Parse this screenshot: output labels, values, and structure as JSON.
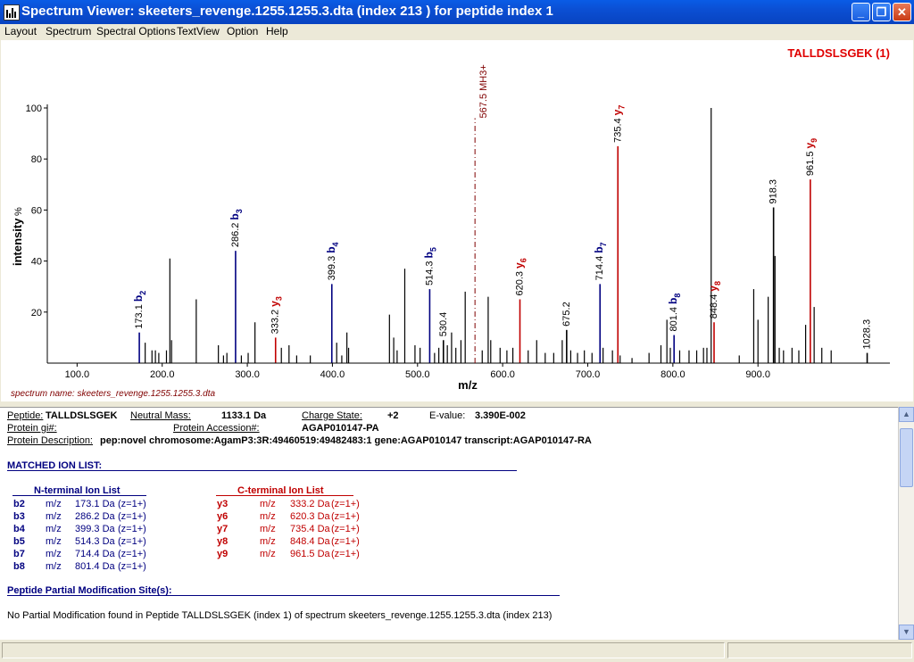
{
  "window": {
    "title": "Spectrum Viewer: skeeters_revenge.1255.1255.3.dta (index 213 ) for peptide index 1",
    "minimize_glyph": "_",
    "maximize_glyph": "❐",
    "close_glyph": "✕",
    "app_icon": "spectrum-icon"
  },
  "menu": [
    "Layout",
    "Spectrum",
    "Spectral Options",
    "TextView",
    "Option",
    "Help"
  ],
  "plot": {
    "peptide_label": "TALLDSLSGEK (1)",
    "ylabel": "intensity",
    "ylabel_unit": "%",
    "xlabel": "m/z",
    "spectrum_name": "spectrum name: skeeters_revenge.1255.1255.3.dta",
    "precursor_label": "567.5 MH3+"
  },
  "chart_data": {
    "type": "bar",
    "xlim": [
      65,
      1055
    ],
    "ylim": [
      0,
      100
    ],
    "x_ticks": [
      100,
      200,
      300,
      400,
      500,
      600,
      700,
      800,
      900
    ],
    "x_tick_labels": [
      "100.0",
      "200.0",
      "300.0",
      "400.0",
      "500.0",
      "600.0",
      "700.0",
      "800.0",
      "900.0"
    ],
    "y_ticks": [
      20,
      40,
      60,
      80,
      100
    ],
    "y_tick_labels": [
      "20",
      "40",
      "60",
      "80",
      "100"
    ],
    "precursor_mz": 567.5,
    "peaks": [
      {
        "mz": 173.1,
        "y": 12,
        "type": "b",
        "label": "173.1",
        "ion": "b",
        "idx": "2"
      },
      {
        "mz": 180,
        "y": 8
      },
      {
        "mz": 188,
        "y": 5
      },
      {
        "mz": 192,
        "y": 5
      },
      {
        "mz": 196,
        "y": 4
      },
      {
        "mz": 205,
        "y": 5
      },
      {
        "mz": 209,
        "y": 41
      },
      {
        "mz": 211,
        "y": 9
      },
      {
        "mz": 240,
        "y": 25
      },
      {
        "mz": 266,
        "y": 7
      },
      {
        "mz": 272,
        "y": 3
      },
      {
        "mz": 276,
        "y": 4
      },
      {
        "mz": 286.2,
        "y": 44,
        "type": "b",
        "label": "286.2",
        "ion": "b",
        "idx": "3"
      },
      {
        "mz": 293,
        "y": 3
      },
      {
        "mz": 301,
        "y": 4
      },
      {
        "mz": 309,
        "y": 16
      },
      {
        "mz": 333.2,
        "y": 10,
        "type": "y",
        "label": "333.2",
        "ion": "y",
        "idx": "3"
      },
      {
        "mz": 340,
        "y": 6
      },
      {
        "mz": 349,
        "y": 7
      },
      {
        "mz": 358,
        "y": 3
      },
      {
        "mz": 374,
        "y": 3
      },
      {
        "mz": 399.3,
        "y": 31,
        "type": "b",
        "label": "399.3",
        "ion": "b",
        "idx": "4"
      },
      {
        "mz": 405,
        "y": 8
      },
      {
        "mz": 411,
        "y": 3
      },
      {
        "mz": 417,
        "y": 12
      },
      {
        "mz": 419,
        "y": 6
      },
      {
        "mz": 467,
        "y": 19
      },
      {
        "mz": 472,
        "y": 10
      },
      {
        "mz": 476,
        "y": 5
      },
      {
        "mz": 485,
        "y": 37
      },
      {
        "mz": 497,
        "y": 7
      },
      {
        "mz": 503,
        "y": 6
      },
      {
        "mz": 514.3,
        "y": 29,
        "type": "b",
        "label": "514.3",
        "ion": "b",
        "idx": "5"
      },
      {
        "mz": 520,
        "y": 4
      },
      {
        "mz": 525,
        "y": 6
      },
      {
        "mz": 530.4,
        "y": 9,
        "label": "530.4"
      },
      {
        "mz": 535,
        "y": 7
      },
      {
        "mz": 540,
        "y": 12
      },
      {
        "mz": 545,
        "y": 6
      },
      {
        "mz": 551,
        "y": 9
      },
      {
        "mz": 556,
        "y": 28
      },
      {
        "mz": 576,
        "y": 5
      },
      {
        "mz": 583,
        "y": 26
      },
      {
        "mz": 586,
        "y": 9
      },
      {
        "mz": 597,
        "y": 6
      },
      {
        "mz": 605,
        "y": 5
      },
      {
        "mz": 612,
        "y": 6
      },
      {
        "mz": 620.3,
        "y": 25,
        "type": "y",
        "label": "620.3",
        "ion": "y",
        "idx": "6"
      },
      {
        "mz": 630,
        "y": 5
      },
      {
        "mz": 640,
        "y": 9
      },
      {
        "mz": 650,
        "y": 4
      },
      {
        "mz": 660,
        "y": 4
      },
      {
        "mz": 670,
        "y": 9
      },
      {
        "mz": 675.2,
        "y": 13,
        "label": "675.2"
      },
      {
        "mz": 680,
        "y": 5
      },
      {
        "mz": 688,
        "y": 4
      },
      {
        "mz": 696,
        "y": 5
      },
      {
        "mz": 705,
        "y": 4
      },
      {
        "mz": 714.4,
        "y": 31,
        "type": "b",
        "label": "714.4",
        "ion": "b",
        "idx": "7"
      },
      {
        "mz": 718,
        "y": 6
      },
      {
        "mz": 729,
        "y": 5
      },
      {
        "mz": 735.4,
        "y": 85,
        "type": "y",
        "label": "735.4",
        "ion": "y",
        "idx": "7"
      },
      {
        "mz": 738,
        "y": 3
      },
      {
        "mz": 752,
        "y": 2
      },
      {
        "mz": 772,
        "y": 4
      },
      {
        "mz": 786,
        "y": 7
      },
      {
        "mz": 793,
        "y": 17
      },
      {
        "mz": 797,
        "y": 6
      },
      {
        "mz": 801.4,
        "y": 11,
        "type": "b",
        "label": "801.4",
        "ion": "b",
        "idx": "8"
      },
      {
        "mz": 808,
        "y": 5
      },
      {
        "mz": 819,
        "y": 5
      },
      {
        "mz": 828,
        "y": 5
      },
      {
        "mz": 836,
        "y": 6
      },
      {
        "mz": 840,
        "y": 6
      },
      {
        "mz": 845,
        "y": 100
      },
      {
        "mz": 848.4,
        "y": 16,
        "type": "y",
        "label": "848.4",
        "ion": "y",
        "idx": "8"
      },
      {
        "mz": 878,
        "y": 3
      },
      {
        "mz": 895,
        "y": 29
      },
      {
        "mz": 900,
        "y": 17
      },
      {
        "mz": 912,
        "y": 26
      },
      {
        "mz": 918.3,
        "y": 61,
        "label": "918.3"
      },
      {
        "mz": 920,
        "y": 42
      },
      {
        "mz": 925,
        "y": 6
      },
      {
        "mz": 930,
        "y": 5
      },
      {
        "mz": 940,
        "y": 6
      },
      {
        "mz": 948,
        "y": 5
      },
      {
        "mz": 956,
        "y": 15
      },
      {
        "mz": 961.5,
        "y": 72,
        "type": "y",
        "label": "961.5",
        "ion": "y",
        "idx": "9"
      },
      {
        "mz": 966,
        "y": 22
      },
      {
        "mz": 975,
        "y": 6
      },
      {
        "mz": 986,
        "y": 5
      },
      {
        "mz": 1028.3,
        "y": 4,
        "label": "1028.3"
      }
    ]
  },
  "header": {
    "peptide_label": "Peptide:",
    "peptide_value": "TALLDSLSGEK",
    "neutral_mass_label": "Neutral Mass:",
    "neutral_mass_value": "1133.1 Da",
    "charge_state_label": "Charge State:",
    "charge_state_value": "+2",
    "evalue_label": "E-value:",
    "evalue_value": "3.390E-002",
    "protein_gi_label": "Protein gi#:",
    "protein_accession_label": "Protein Accession#:",
    "protein_accession_value": "AGAP010147-PA",
    "protein_description_label": "Protein Description:",
    "protein_description_value": "pep:novel chromosome:AgamP3:3R:49460519:49482483:1 gene:AGAP010147 transcript:AGAP010147-RA"
  },
  "matched_ions": {
    "title": "MATCHED ION LIST:",
    "n_title": "N-terminal Ion List",
    "c_title": "C-terminal Ion List",
    "n_ions": [
      {
        "ion": "b2",
        "mz": "m/z",
        "value": "173.1 Da",
        "z": "(z=1+)"
      },
      {
        "ion": "b3",
        "mz": "m/z",
        "value": "286.2 Da",
        "z": "(z=1+)"
      },
      {
        "ion": "b4",
        "mz": "m/z",
        "value": "399.3 Da",
        "z": "(z=1+)"
      },
      {
        "ion": "b5",
        "mz": "m/z",
        "value": "514.3 Da",
        "z": "(z=1+)"
      },
      {
        "ion": "b7",
        "mz": "m/z",
        "value": "714.4 Da",
        "z": "(z=1+)"
      },
      {
        "ion": "b8",
        "mz": "m/z",
        "value": "801.4 Da",
        "z": "(z=1+)"
      }
    ],
    "c_ions": [
      {
        "ion": "y3",
        "mz": "m/z",
        "value": "333.2 Da",
        "z": "(z=1+)"
      },
      {
        "ion": "y6",
        "mz": "m/z",
        "value": "620.3 Da",
        "z": "(z=1+)"
      },
      {
        "ion": "y7",
        "mz": "m/z",
        "value": "735.4 Da",
        "z": "(z=1+)"
      },
      {
        "ion": "y8",
        "mz": "m/z",
        "value": "848.4 Da",
        "z": "(z=1+)"
      },
      {
        "ion": "y9",
        "mz": "m/z",
        "value": "961.5 Da",
        "z": "(z=1+)"
      }
    ]
  },
  "modification": {
    "title": "Peptide Partial Modification Site(s):",
    "text": "No Partial Modification found in Peptide TALLDSLSGEK (index 1) of spectrum skeeters_revenge.1255.1255.3.dta (index 213)"
  },
  "colors": {
    "b_ion": "#000080",
    "y_ion": "#c00000",
    "precursor": "#800000",
    "peak": "#000000"
  }
}
